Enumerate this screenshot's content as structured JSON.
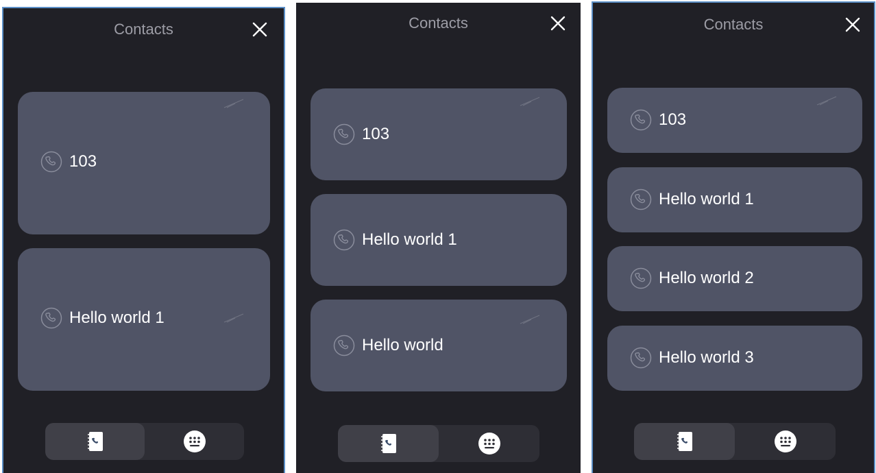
{
  "screens": [
    {
      "title": "Contacts",
      "contacts": [
        {
          "name": "103",
          "icon": "phone-icon"
        },
        {
          "name": "Hello world 1",
          "icon": "phone-icon"
        }
      ],
      "tabs": [
        {
          "name": "contacts-book-icon",
          "active": true
        },
        {
          "name": "dialpad-icon",
          "active": false
        }
      ]
    },
    {
      "title": "Contacts",
      "contacts": [
        {
          "name": "103",
          "icon": "phone-icon"
        },
        {
          "name": "Hello world 1",
          "icon": "phone-icon"
        },
        {
          "name": "Hello world",
          "icon": "phone-icon"
        }
      ],
      "tabs": [
        {
          "name": "contacts-book-icon",
          "active": true
        },
        {
          "name": "dialpad-icon",
          "active": false
        }
      ]
    },
    {
      "title": "Contacts",
      "contacts": [
        {
          "name": "103",
          "icon": "phone-icon"
        },
        {
          "name": "Hello world 1",
          "icon": "phone-icon"
        },
        {
          "name": "Hello world 2",
          "icon": "phone-icon"
        },
        {
          "name": "Hello world 3",
          "icon": "phone-icon"
        }
      ],
      "tabs": [
        {
          "name": "contacts-book-icon",
          "active": true
        },
        {
          "name": "dialpad-icon",
          "active": false
        }
      ]
    }
  ],
  "colors": {
    "background": "#202026",
    "card": "#505466",
    "tabbar": "#2e2e35",
    "tab_active": "#404048",
    "title_text": "#9d9da6",
    "card_text": "#ffffff",
    "frame_border": "#5b8fc7"
  }
}
